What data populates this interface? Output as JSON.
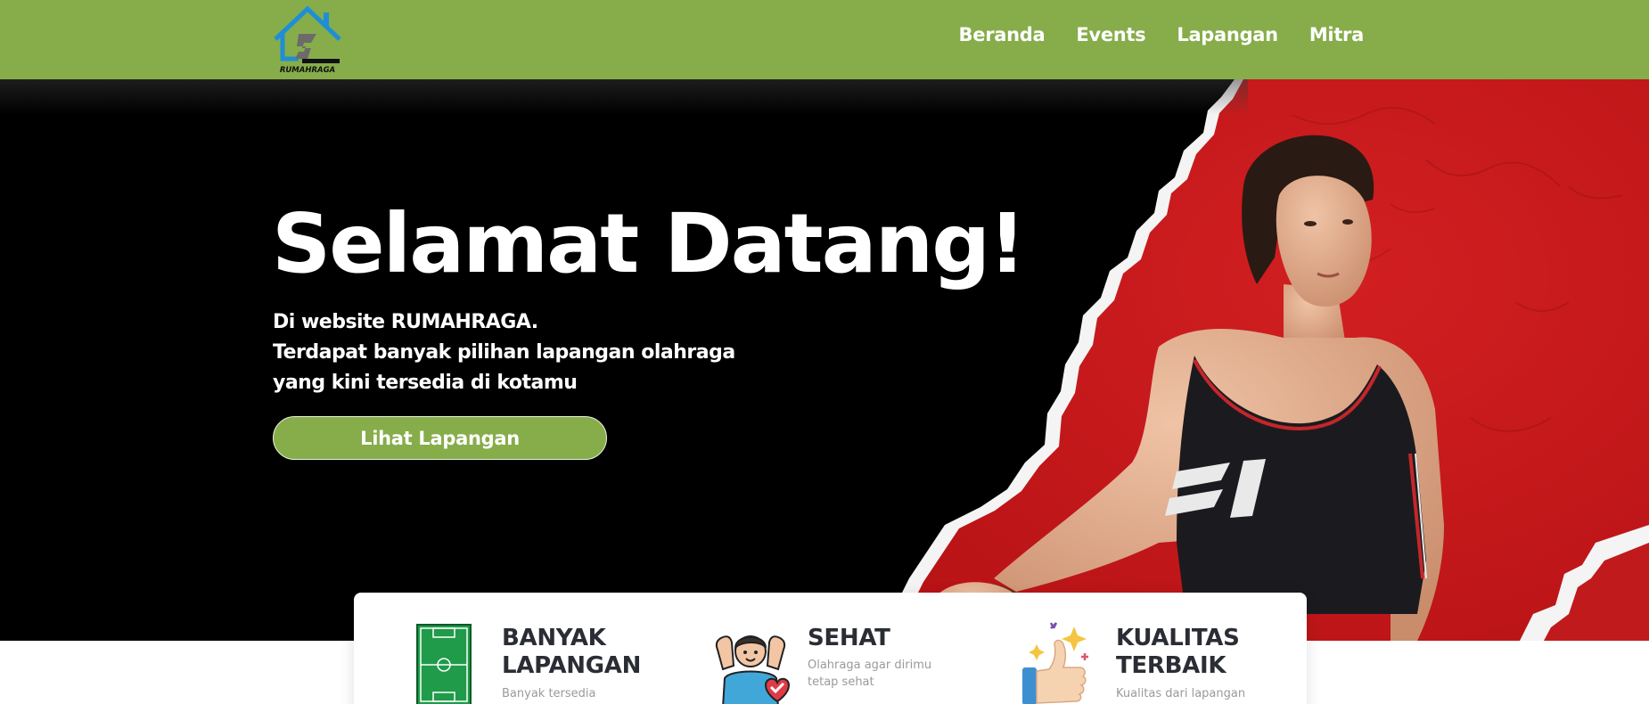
{
  "brand": {
    "name": "RUMAHRAGA"
  },
  "nav": {
    "items": [
      "Beranda",
      "Events",
      "Lapangan",
      "Mitra"
    ]
  },
  "hero": {
    "title": "Selamat Datang!",
    "lines": [
      "Di website RUMAHRAGA.",
      "Terdapat banyak pilihan lapangan olahraga",
      "yang kini tersedia di kotamu"
    ],
    "cta_label": "Lihat Lapangan"
  },
  "features": [
    {
      "title_lines": [
        "BANYAK",
        "LAPANGAN"
      ],
      "desc_lines": [
        "Banyak tersedia"
      ],
      "icon": "soccer-field-icon"
    },
    {
      "title_lines": [
        "SEHAT"
      ],
      "desc_lines": [
        "Olahraga agar dirimu",
        "tetap sehat"
      ],
      "icon": "healthy-person-icon"
    },
    {
      "title_lines": [
        "KUALITAS",
        "TERBAIK"
      ],
      "desc_lines": [
        "Kualitas dari lapangan"
      ],
      "icon": "thumbs-up-icon"
    }
  ],
  "colors": {
    "navbar": "#86ad4a",
    "hero_background": "#000000",
    "hero_accent": "#c8181b",
    "button": "#86ad4a",
    "card_title": "#2a2d34",
    "card_text": "#9a9a9a"
  }
}
